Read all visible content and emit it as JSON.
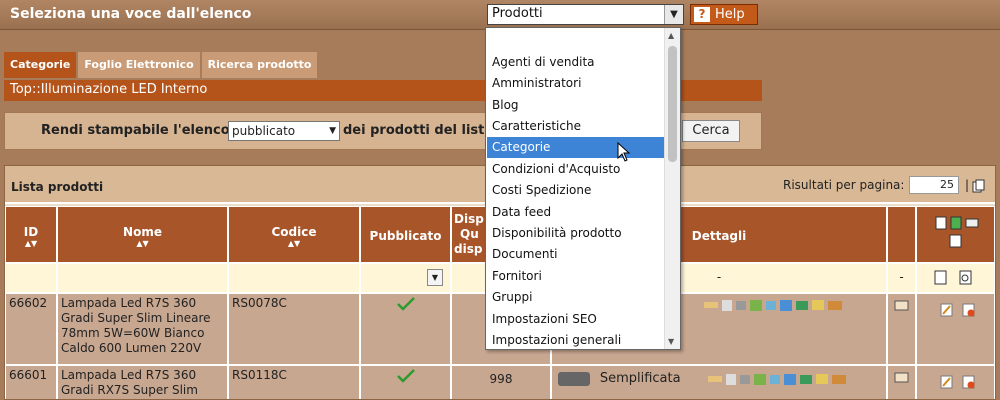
{
  "topbar": {
    "title": "Seleziona una voce dall'elenco",
    "select_value": "Prodotti",
    "help_label": "Help"
  },
  "tabs": [
    "Categorie",
    "Foglio Elettronico",
    "Ricerca prodotto"
  ],
  "breadcrumb": "Top::Illuminazione LED Interno",
  "printbar": {
    "label_before": "Rendi stampabile l'elenco",
    "publish_value": "pubblicato",
    "label_after": "dei prodotti del listi",
    "search_button": "Cerca"
  },
  "list": {
    "title": "Lista prodotti",
    "results_label": "Risultati per pagina:",
    "results_value": "25",
    "separator": "|",
    "headers": {
      "id": "ID",
      "nome": "Nome",
      "codice": "Codice",
      "pubblicato": "Pubblicato",
      "disp_1": "Disp",
      "disp_2": "Qu",
      "disp_3": "disp",
      "dettagli": "Dettagli"
    },
    "filter_dash_1": "-",
    "filter_dash_2": "-",
    "rows": [
      {
        "id": "66602",
        "nome": "Lampada Led R7S 360 Gradi Super Slim Lineare 78mm 5W=60W Bianco Caldo 600 Lumen 220V",
        "codice": "RS0078C",
        "qty": "",
        "mode": ""
      },
      {
        "id": "66601",
        "nome": "Lampada Led R7S 360 Gradi RX7S Super Slim",
        "codice": "RS0118C",
        "qty": "998",
        "mode": "Semplificata"
      }
    ]
  },
  "dropdown": {
    "options": [
      "Agenti di vendita",
      "Amministratori",
      "Blog",
      "Caratteristiche",
      "Categorie",
      "Condizioni d'Acquisto",
      "Costi Spedizione",
      "Data feed",
      "Disponibilità prodotto",
      "Documenti",
      "Fornitori",
      "Gruppi",
      "Impostazioni SEO",
      "Impostazioni generali"
    ],
    "highlighted": "Categorie"
  },
  "colors": {
    "background": "#a67c5b",
    "accent": "#b4541b",
    "header_cell": "#a8552a",
    "highlight": "#3d84d6",
    "check": "#2e9a2e"
  }
}
